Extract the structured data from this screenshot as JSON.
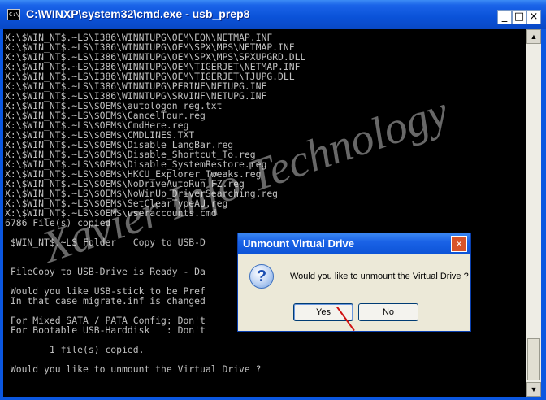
{
  "window": {
    "title": "C:\\WINXP\\system32\\cmd.exe - usb_prep8",
    "icon_text": "C:\\",
    "min_glyph": "_",
    "max_glyph": "□",
    "close_glyph": "×"
  },
  "console": {
    "lines": [
      "X:\\$WIN_NT$.~LS\\I386\\WINNTUPG\\OEM\\EQN\\NETMAP.INF",
      "X:\\$WIN_NT$.~LS\\I386\\WINNTUPG\\OEM\\SPX\\MPS\\NETMAP.INF",
      "X:\\$WIN_NT$.~LS\\I386\\WINNTUPG\\OEM\\SPX\\MPS\\SPXUPGRD.DLL",
      "X:\\$WIN_NT$.~LS\\I386\\WINNTUPG\\OEM\\TIGERJET\\NETMAP.INF",
      "X:\\$WIN_NT$.~LS\\I386\\WINNTUPG\\OEM\\TIGERJET\\TJUPG.DLL",
      "X:\\$WIN_NT$.~LS\\I386\\WINNTUPG\\PERINF\\NETUPG.INF",
      "X:\\$WIN_NT$.~LS\\I386\\WINNTUPG\\SRVINF\\NETUPG.INF",
      "X:\\$WIN_NT$.~LS\\$OEM$\\autologon_reg.txt",
      "X:\\$WIN_NT$.~LS\\$OEM$\\CancelTour.reg",
      "X:\\$WIN_NT$.~LS\\$OEM$\\CmdHere.reg",
      "X:\\$WIN_NT$.~LS\\$OEM$\\CMDLINES.TXT",
      "X:\\$WIN_NT$.~LS\\$OEM$\\Disable_LangBar.reg",
      "X:\\$WIN_NT$.~LS\\$OEM$\\Disable_Shortcut_To.reg",
      "X:\\$WIN_NT$.~LS\\$OEM$\\Disable_SystemRestore.reg",
      "X:\\$WIN_NT$.~LS\\$OEM$\\HKCU_Explorer_Tweaks.reg",
      "X:\\$WIN_NT$.~LS\\$OEM$\\NoDriveAutoRun_FZ.reg",
      "X:\\$WIN_NT$.~LS\\$OEM$\\NoWinUp_DriverSearching.reg",
      "X:\\$WIN_NT$.~LS\\$OEM$\\SetClearTypeAU.reg",
      "X:\\$WIN_NT$.~LS\\$OEM$\\useraccounts.cmd",
      "6786 File(s) copied",
      "",
      " $WIN_NT$.~LS Folder   Copy to USB-D",
      "",
      "",
      " FileCopy to USB-Drive is Ready - Da",
      "",
      " Would you like USB-stick to be Pref",
      " In that case migrate.inf is changed",
      "",
      " For Mixed SATA / PATA Config: Don't",
      " For Bootable USB-Harddisk   : Don't",
      "",
      "",
      "        1 file(s) copied.",
      "",
      " Would you like to unmount the Virtual Drive ?"
    ]
  },
  "watermark": "Xavier Info Technology",
  "scrollbar": {
    "up_glyph": "▲",
    "down_glyph": "▼"
  },
  "dialog": {
    "title": "Unmount Virtual Drive",
    "close_glyph": "×",
    "icon_glyph": "?",
    "message": "Would you like to unmount the Virtual Drive ?",
    "yes_label": "Yes",
    "no_label": "No"
  }
}
